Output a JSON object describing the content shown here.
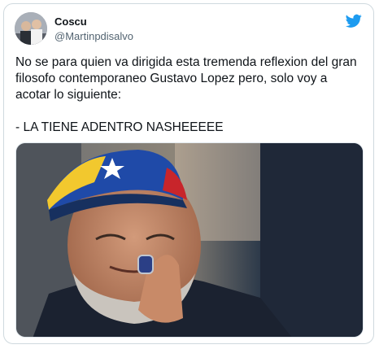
{
  "tweet": {
    "author_name": "Coscu",
    "author_handle": "@Martinpdisalvo",
    "text": "No se para quien va dirigida esta tremenda reflexion del gran filosofo contemporaneo Gustavo Lopez pero, solo voy a acotar lo siguiente:\n\n- LA TIENE ADENTRO NASHEEEEE",
    "brand_icon": "twitter-bird-icon",
    "brand_color": "#1d9bf0"
  }
}
